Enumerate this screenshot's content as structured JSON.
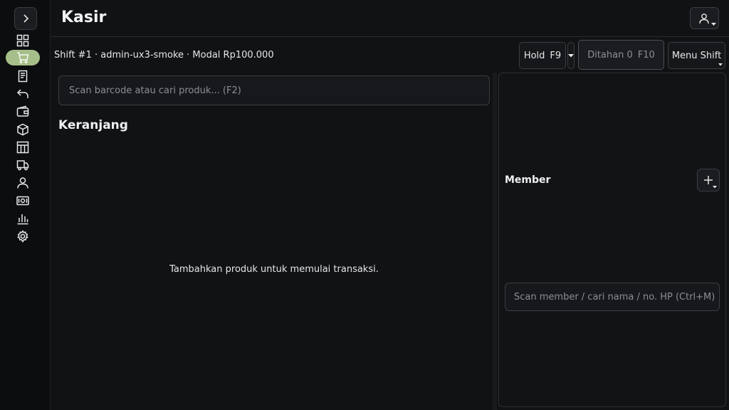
{
  "header": {
    "title": "Kasir"
  },
  "sidebar": {
    "items": [
      {
        "icon": "dashboard-icon",
        "active": false
      },
      {
        "icon": "cart-icon",
        "active": true
      },
      {
        "icon": "receipt-icon",
        "active": false
      },
      {
        "icon": "undo-icon",
        "active": false
      },
      {
        "icon": "wallet-icon",
        "active": false
      },
      {
        "icon": "box-icon",
        "active": false
      },
      {
        "icon": "table-icon",
        "active": false
      },
      {
        "icon": "truck-icon",
        "active": false
      },
      {
        "icon": "user-icon",
        "active": false
      },
      {
        "icon": "cash-icon",
        "active": false
      },
      {
        "icon": "chart-icon",
        "active": false
      },
      {
        "icon": "gear-icon",
        "active": false
      }
    ],
    "active_color": "#a6bf8a"
  },
  "shift": {
    "info": "Shift #1 · admin-ux3-smoke · Modal Rp100.000",
    "hold_label": "Hold",
    "hold_key": "F9",
    "ditahan_label": "Ditahan 0",
    "ditahan_key": "F10",
    "menu_label": "Menu Shift"
  },
  "search": {
    "placeholder": "Scan barcode atau cari produk...  (F2)"
  },
  "cart": {
    "title": "Keranjang",
    "empty_message": "Tambahkan produk untuk memulai transaksi."
  },
  "member": {
    "title": "Member",
    "search_placeholder": "Scan member / cari nama / no. HP  (Ctrl+M)"
  }
}
